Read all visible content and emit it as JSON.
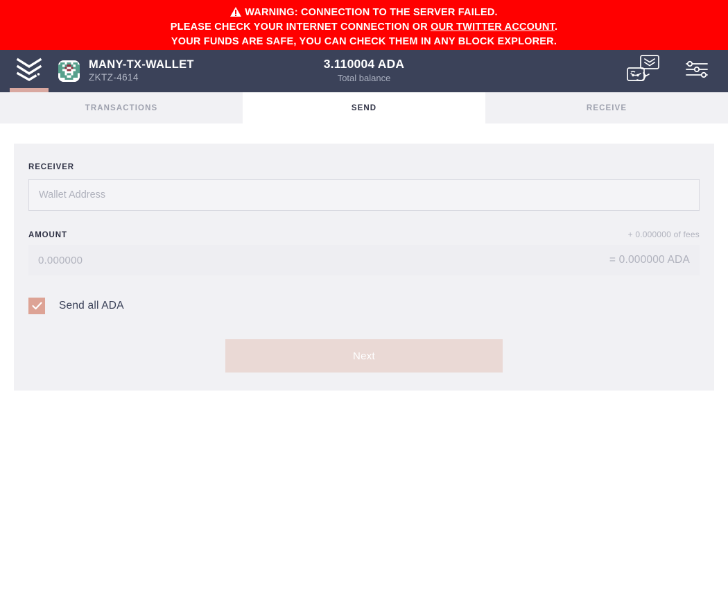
{
  "warning": {
    "icon": "warning-triangle-icon",
    "line1": "WARNING: CONNECTION TO THE SERVER FAILED.",
    "line2_prefix": "PLEASE CHECK YOUR INTERNET CONNECTION OR ",
    "link_text": "OUR TWITTER ACCOUNT",
    "line2_suffix": ".",
    "line3": "YOUR FUNDS ARE SAFE, YOU CAN CHECK THEM IN ANY BLOCK EXPLORER.",
    "background_color": "#ff0000",
    "text_color": "#ffffff"
  },
  "header": {
    "logo_icon": "daedalus-chevrons-logo-icon",
    "accent_color": "#d9a8a0",
    "background_color": "#3b4259",
    "wallet": {
      "avatar_icon": "wallet-identicon-avatar",
      "name": "MANY-TX-WALLET",
      "id": "ZKTZ-4614"
    },
    "balance": {
      "amount": "3.110004 ADA",
      "label": "Total balance"
    },
    "actions": [
      {
        "icon": "wallet-switch-icon",
        "name": "switch-wallet-button"
      },
      {
        "icon": "settings-sliders-icon",
        "name": "settings-button"
      }
    ]
  },
  "tabs": [
    {
      "label": "TRANSACTIONS",
      "active": false
    },
    {
      "label": "SEND",
      "active": true
    },
    {
      "label": "RECEIVE",
      "active": false
    }
  ],
  "send_form": {
    "receiver": {
      "label": "RECEIVER",
      "placeholder": "Wallet Address",
      "value": ""
    },
    "amount": {
      "label": "AMOUNT",
      "fees_note": "+ 0.000000 of fees",
      "value": "0.000000",
      "equals": "= 0.000000 ADA"
    },
    "send_all": {
      "label": "Send all ADA",
      "checked": true,
      "checkbox_color": "#dda395",
      "check_icon": "checkmark-icon"
    },
    "submit": {
      "label": "Next",
      "disabled": true,
      "color": "#ead9d5"
    }
  }
}
